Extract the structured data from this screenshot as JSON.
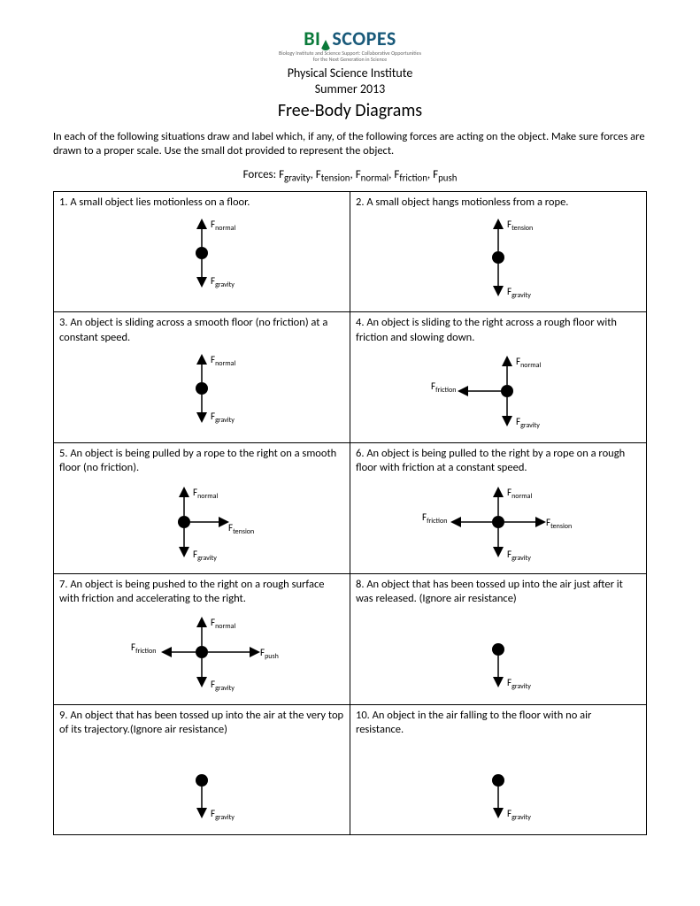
{
  "logo": {
    "part1": "BI",
    "part2": "SCOPES",
    "sub1": "Biology Institute and Science Support: Collaborative Opportunities",
    "sub2": "for the Next Generation in Science"
  },
  "header": {
    "line1": "Physical Science Institute",
    "line2": "Summer 2013"
  },
  "title": "Free-Body Diagrams",
  "instructions": "In each of the following situations draw and label which, if any, of the following forces are acting on the object. Make sure forces are drawn to a proper scale. Use the small dot provided to represent the object.",
  "forces_prefix": "Forces:  ",
  "forces": [
    {
      "f": "F",
      "sub": "gravity"
    },
    {
      "f": "F",
      "sub": "tension"
    },
    {
      "f": "F",
      "sub": "normal"
    },
    {
      "f": "F",
      "sub": "friction"
    },
    {
      "f": "F",
      "sub": "push"
    }
  ],
  "labels": {
    "normal": {
      "f": "F",
      "sub": "normal"
    },
    "gravity": {
      "f": "F",
      "sub": "gravity"
    },
    "tension": {
      "f": "F",
      "sub": "tension"
    },
    "friction": {
      "f": "F",
      "sub": "friction"
    },
    "push": {
      "f": "F",
      "sub": "push"
    }
  },
  "cells": [
    {
      "n": "1",
      "text": "1. A small object lies motionless on a floor."
    },
    {
      "n": "2",
      "text": "2. A small object hangs motionless from a rope."
    },
    {
      "n": "3",
      "text": "3. An object is sliding across a smooth floor (no friction) at a constant speed."
    },
    {
      "n": "4",
      "text": "4. An object is sliding to the right across a rough floor with friction and slowing down."
    },
    {
      "n": "5",
      "text": "5. An object is being pulled by a rope to the right on a smooth floor (no friction)."
    },
    {
      "n": "6",
      "text": "6. An object is being pulled to the right by a rope on a rough floor with friction at a constant speed."
    },
    {
      "n": "7",
      "text": "7. An object is being pushed to the right on a rough surface with friction and accelerating to the right."
    },
    {
      "n": "8",
      "text": "8. An object that has been tossed up into the air just after it was released. (Ignore air resistance)"
    },
    {
      "n": "9",
      "text": "9. An object that has been tossed up into the air at the very top of its trajectory.(Ignore air resistance)"
    },
    {
      "n": "10",
      "text": "10. An object in the air falling to the floor with no air resistance."
    }
  ]
}
